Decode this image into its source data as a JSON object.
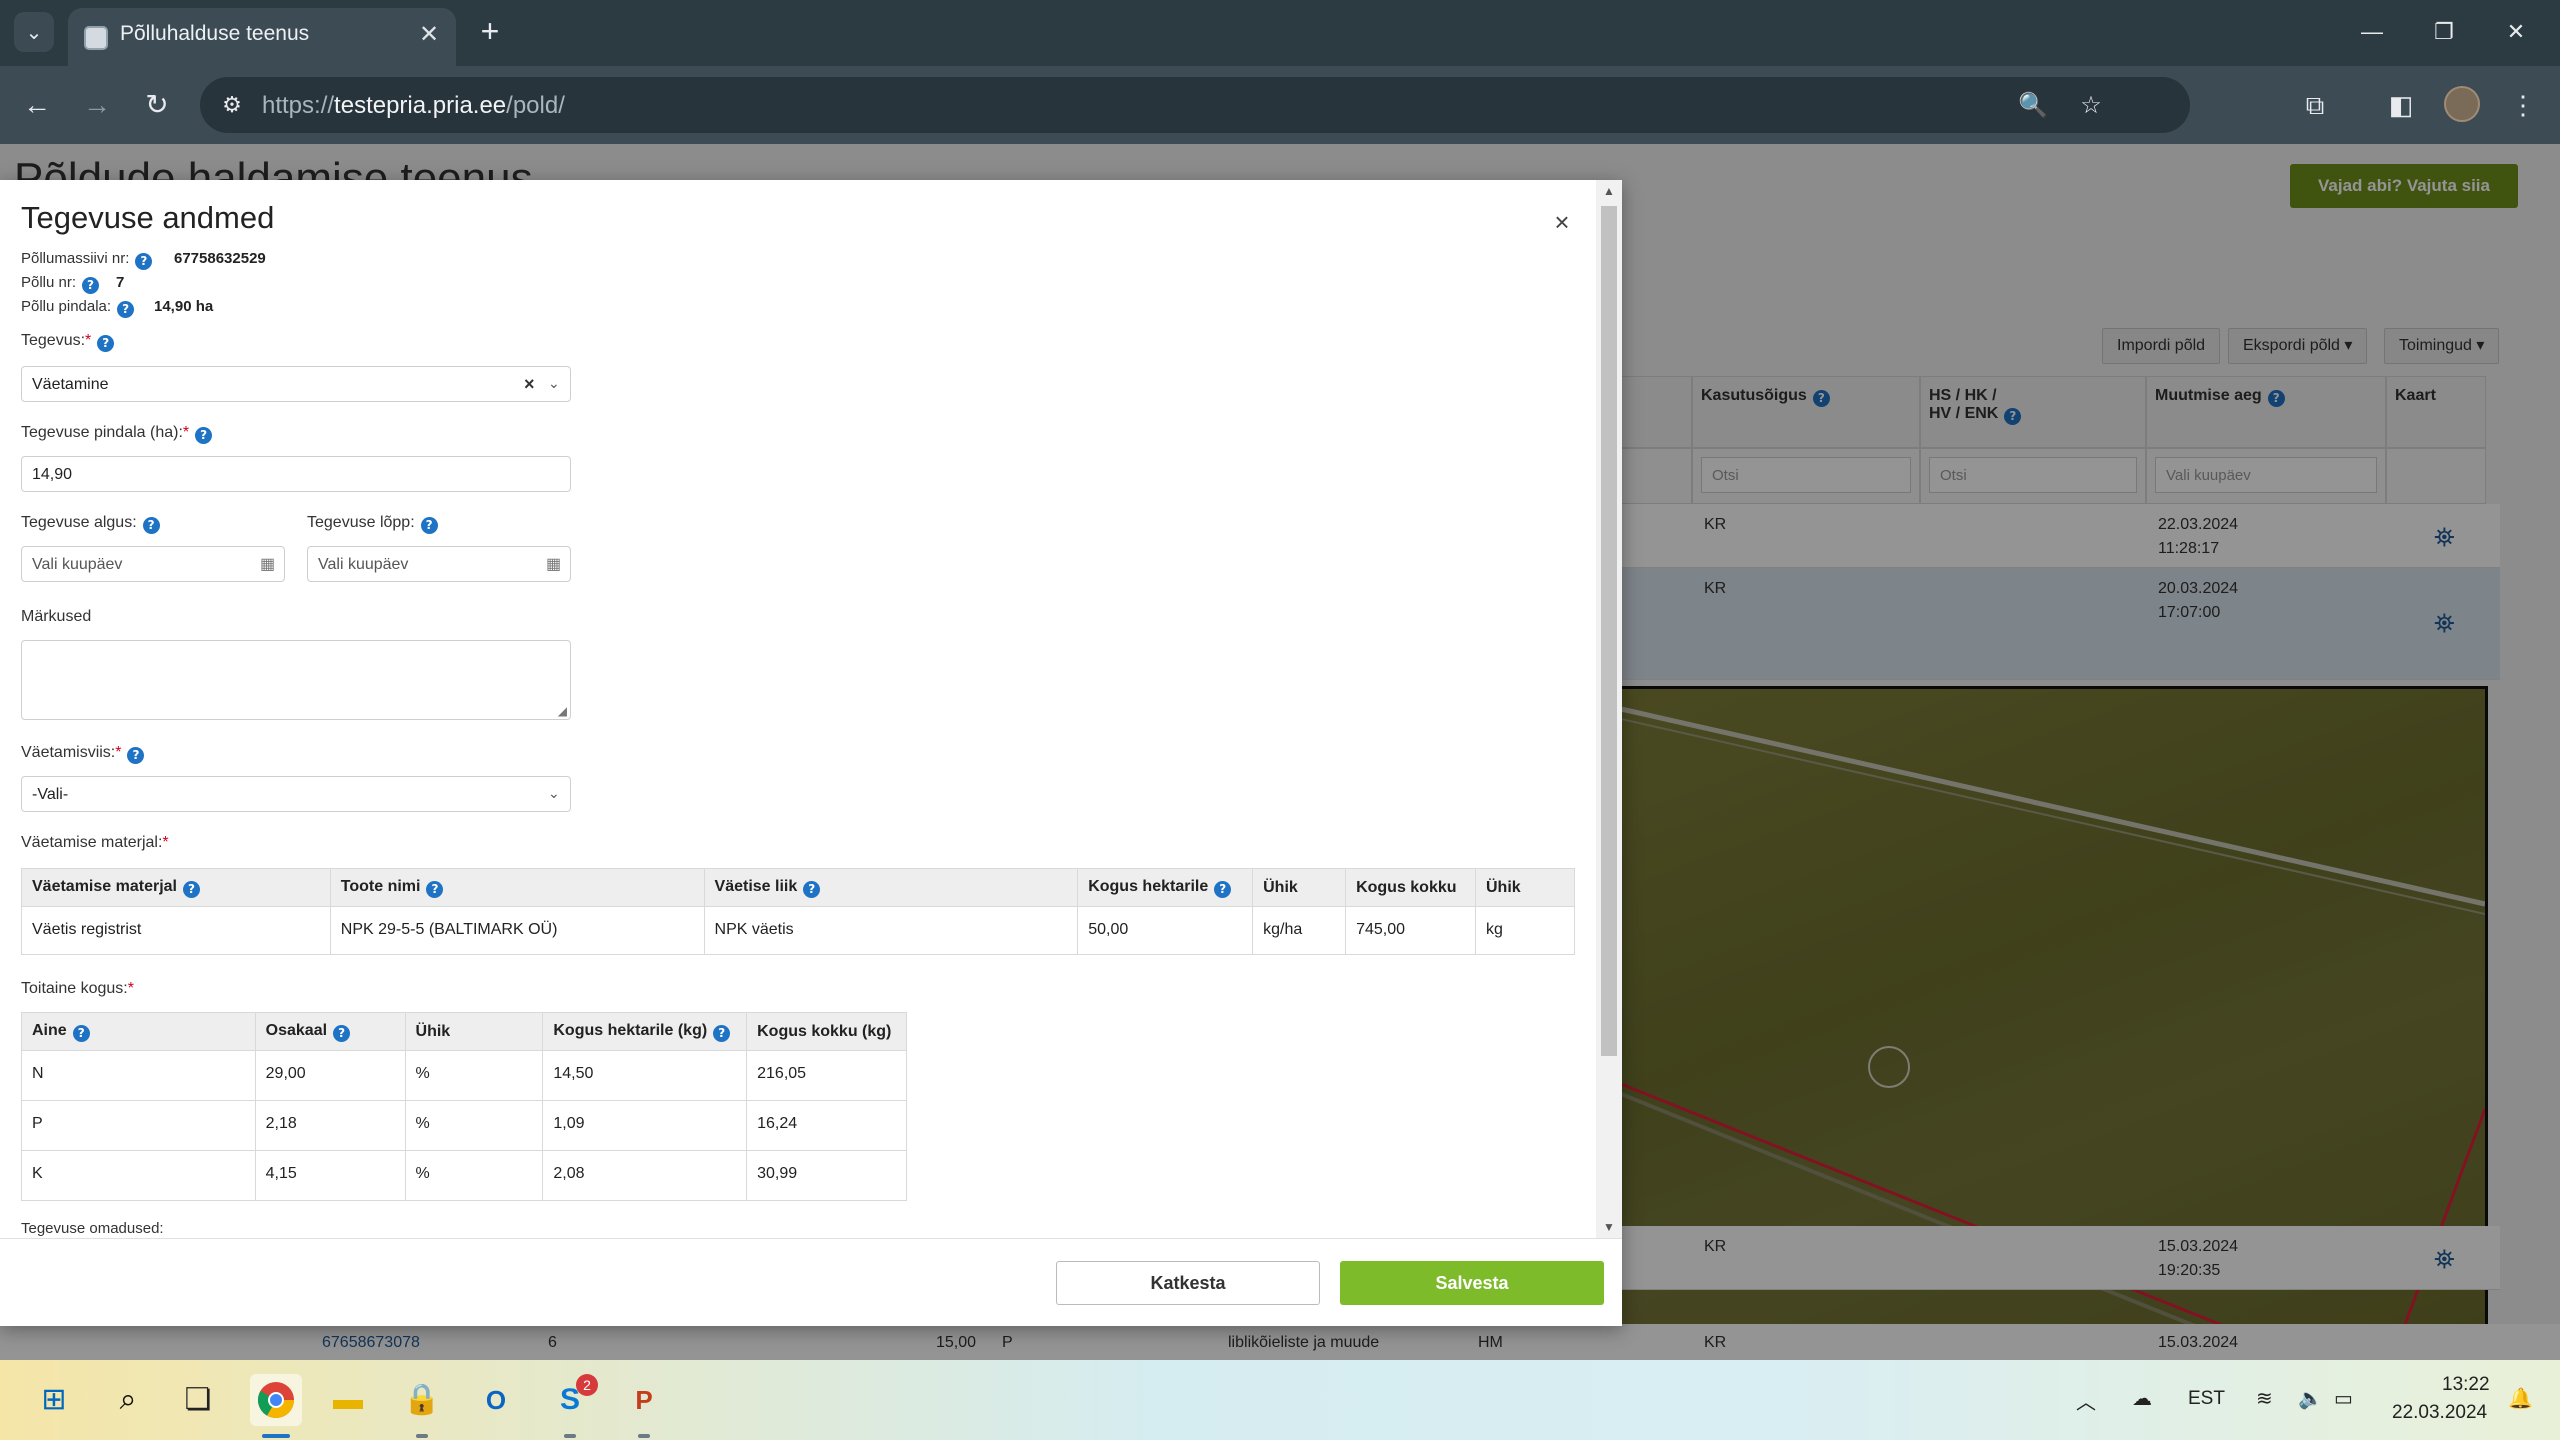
{
  "browser": {
    "tab_title": "Põlluhalduse teenus",
    "url_prefix": "https://",
    "url_host": "testepria.pria.ee",
    "url_path": "/pold/"
  },
  "background": {
    "page_title": "Põldude haldamise teenus",
    "help_button": "Vajad abi? Vajuta siia",
    "buttons": {
      "import": "Impordi põld",
      "export": "Ekspordi põld",
      "actions": "Toimingud"
    },
    "columns": {
      "rights": "Kasutusõigus",
      "hs": "HS / HK /",
      "hs2": "HV / ENK",
      "modified": "Muutmise aeg",
      "map": "Kaart"
    },
    "filters": {
      "search1": "Otsi",
      "search2": "Otsi",
      "date": "Vali kuupäev"
    },
    "rows": [
      {
        "rights": "KR",
        "date": "22.03.2024",
        "time": "11:28:17"
      },
      {
        "rights": "KR",
        "date": "20.03.2024",
        "time": "17:07:00"
      },
      {
        "rights": "KR",
        "date": "15.03.2024",
        "time": "19:20:35"
      },
      {
        "massif": "67658673078",
        "field_no": "6",
        "area": "15,00",
        "type": "P",
        "crop": "liblikõieliste ja muude",
        "code": "HM",
        "rights": "KR",
        "date": "15.03.2024"
      }
    ]
  },
  "modal": {
    "title": "Tegevuse andmed",
    "massif_label": "Põllumassiivi nr:",
    "massif_value": "67758632529",
    "field_no_label": "Põllu nr:",
    "field_no_value": "7",
    "field_area_label": "Põllu pindala:",
    "field_area_value": "14,90 ha",
    "activity_label": "Tegevus:",
    "activity_value": "Väetamine",
    "activity_area_label": "Tegevuse pindala (ha):",
    "activity_area_value": "14,90",
    "start_label": "Tegevuse algus:",
    "start_placeholder": "Vali kuupäev",
    "end_label": "Tegevuse lõpp:",
    "end_placeholder": "Vali kuupäev",
    "notes_label": "Märkused",
    "method_label": "Väetamisviis:",
    "method_value": "-Vali-",
    "material_section": "Väetamise materjal:",
    "material_table": {
      "headers": [
        "Väetamise materjal",
        "Toote nimi",
        "Väetise liik",
        "Kogus hektarile",
        "Ühik",
        "Kogus kokku",
        "Ühik"
      ],
      "rows": [
        [
          "Väetis registrist",
          "NPK 29-5-5 (BALTIMARK OÜ)",
          "NPK väetis",
          "50,00",
          "kg/ha",
          "745,00",
          "kg"
        ]
      ]
    },
    "nutrient_section": "Toitaine kogus:",
    "nutrient_table": {
      "headers": [
        "Aine",
        "Osakaal",
        "Ühik",
        "Kogus hektarile (kg)",
        "Kogus kokku (kg)"
      ],
      "rows": [
        [
          "N",
          "29,00",
          "%",
          "14,50",
          "216,05"
        ],
        [
          "P",
          "2,18",
          "%",
          "1,09",
          "16,24"
        ],
        [
          "K",
          "4,15",
          "%",
          "2,08",
          "30,99"
        ]
      ]
    },
    "properties_label": "Tegevuse omadused:",
    "cancel": "Katkesta",
    "save": "Salvesta"
  },
  "taskbar": {
    "language": "EST",
    "time": "13:22",
    "date": "22.03.2024",
    "skype_badge": "2"
  },
  "colors": {
    "save": "#7dbb2b",
    "help": "#6f8f1a",
    "info": "#1f73c4"
  }
}
